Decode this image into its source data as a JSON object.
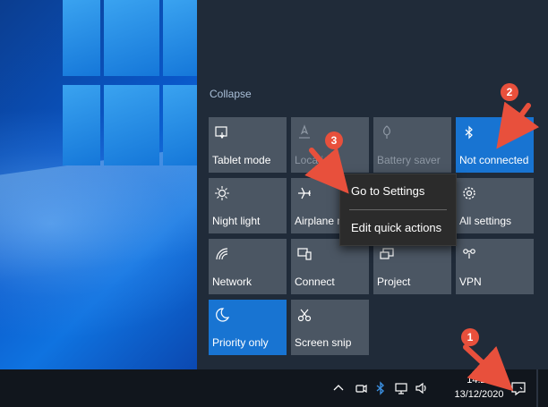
{
  "action_center": {
    "collapse_label": "Collapse",
    "tiles": [
      {
        "label": "Tablet mode",
        "icon": "tablet-mode-icon",
        "state": "off"
      },
      {
        "label": "Location",
        "icon": "location-icon",
        "state": "disabled"
      },
      {
        "label": "Battery saver",
        "icon": "battery-saver-icon",
        "state": "disabled"
      },
      {
        "label": "Not connected",
        "icon": "bluetooth-icon",
        "state": "on"
      },
      {
        "label": "Night light",
        "icon": "night-light-icon",
        "state": "off"
      },
      {
        "label": "Airplane mode",
        "icon": "airplane-icon",
        "state": "off"
      },
      {
        "label": "All settings",
        "icon": "gear-icon",
        "state": "off"
      },
      {
        "label": "Network",
        "icon": "network-icon",
        "state": "off"
      },
      {
        "label": "Connect",
        "icon": "connect-icon",
        "state": "off"
      },
      {
        "label": "Project",
        "icon": "project-icon",
        "state": "off"
      },
      {
        "label": "VPN",
        "icon": "vpn-icon",
        "state": "off"
      },
      {
        "label": "Priority only",
        "icon": "moon-icon",
        "state": "on"
      },
      {
        "label": "Screen snip",
        "icon": "screen-snip-icon",
        "state": "off"
      }
    ]
  },
  "context_menu": {
    "items": [
      "Go to Settings",
      "Edit quick actions"
    ]
  },
  "taskbar": {
    "time": "14:24",
    "date": "13/12/2020",
    "tray_icons": [
      "chevron-up-icon",
      "meet-now-icon",
      "bluetooth-icon",
      "network-icon",
      "volume-icon"
    ],
    "notification_icon": "notification-icon"
  },
  "annotations": {
    "badges": [
      "1",
      "2",
      "3"
    ],
    "color": "#e8503c"
  },
  "colors": {
    "panel": "#202b39",
    "tile": "#4b5663",
    "tile_active": "#1874d2",
    "taskbar": "#11161d"
  }
}
